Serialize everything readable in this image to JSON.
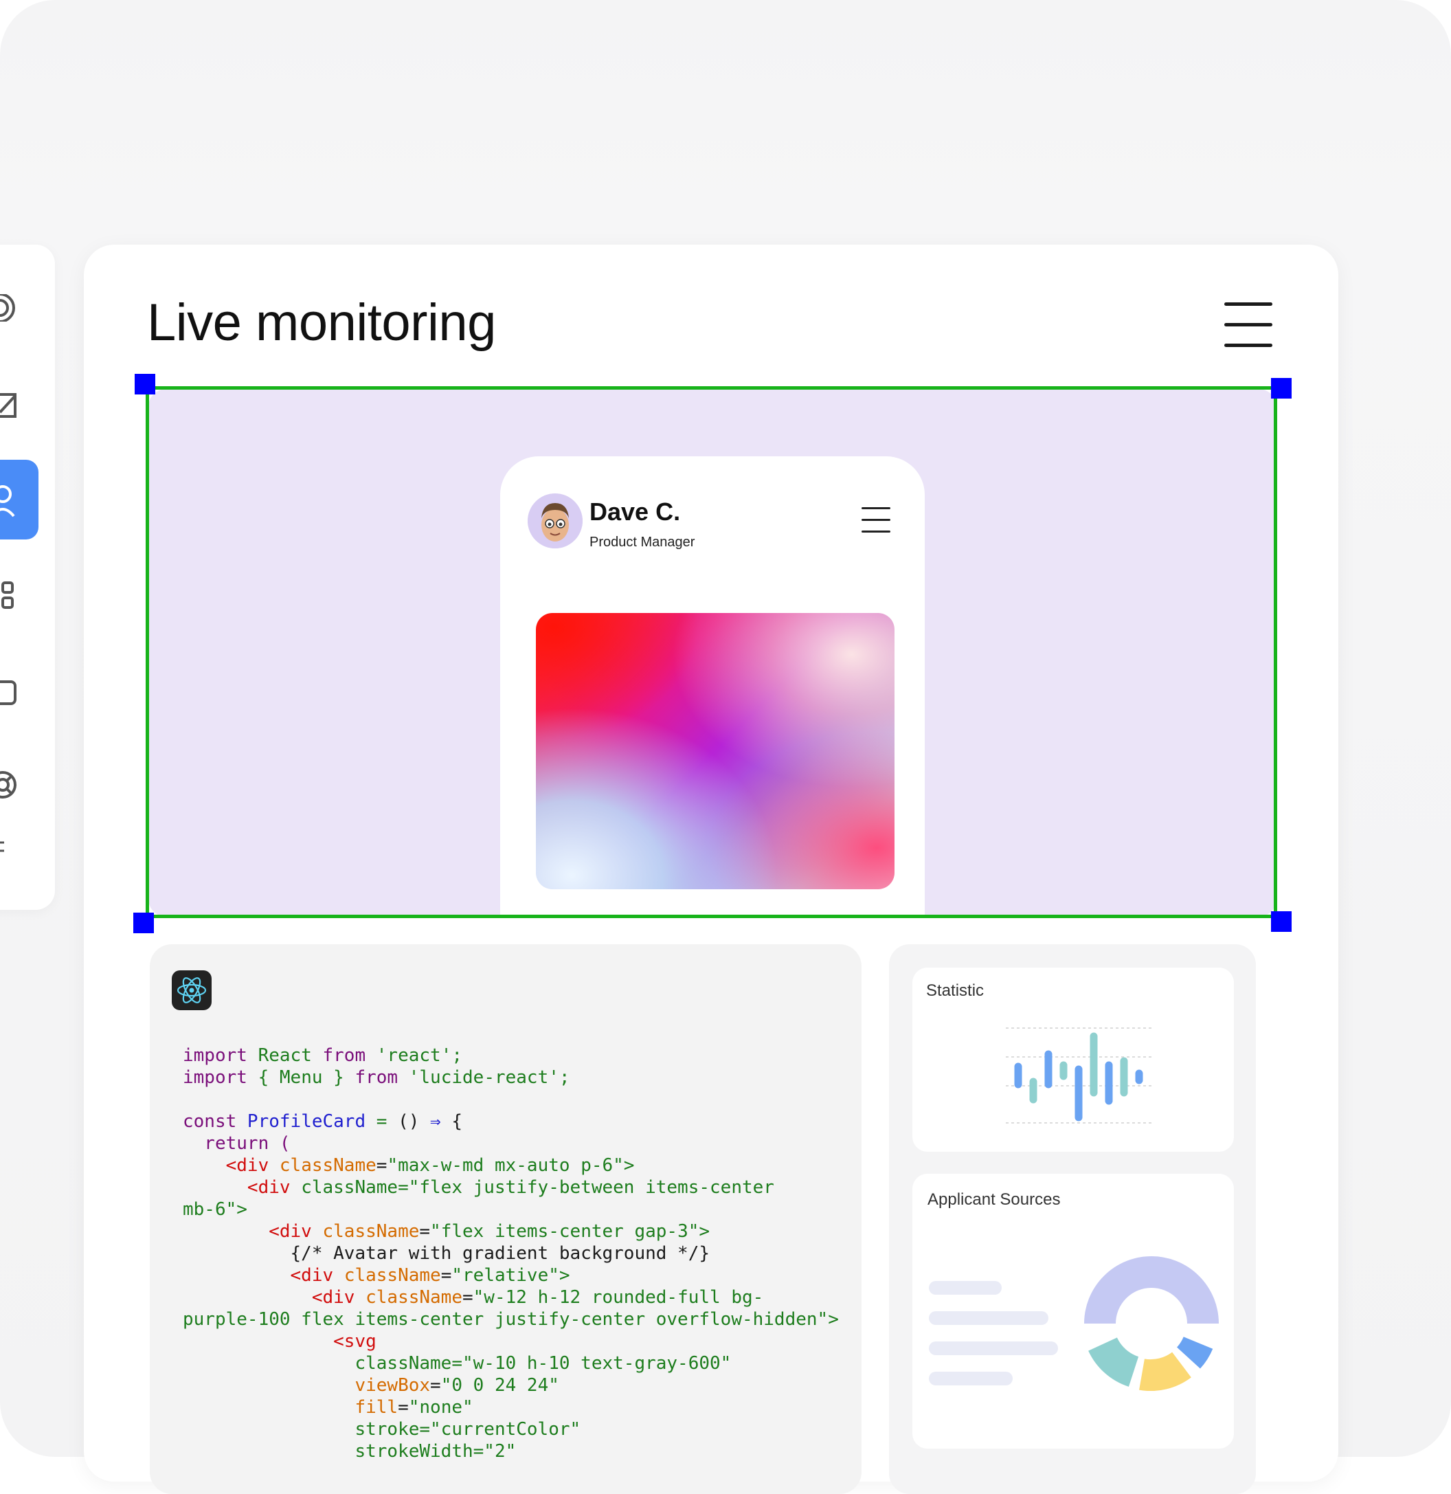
{
  "page": {
    "title": "Live monitoring"
  },
  "profile": {
    "name": "Dave C.",
    "role": "Product Manager"
  },
  "code_snippet": {
    "lines": [
      [
        [
          "kw",
          "import "
        ],
        [
          "str",
          "React "
        ],
        [
          "kw",
          "from "
        ],
        [
          "str",
          "'react';"
        ]
      ],
      [
        [
          "kw",
          "import "
        ],
        [
          "str",
          "{ Menu } "
        ],
        [
          "kw",
          "from "
        ],
        [
          "str",
          "'lucide-react';"
        ]
      ],
      [],
      [
        [
          "kw",
          "const "
        ],
        [
          "id",
          "ProfileCard "
        ],
        [
          "str",
          "= "
        ],
        [
          "plain",
          "() "
        ],
        [
          "id",
          "⇒ "
        ],
        [
          "plain",
          "{"
        ]
      ],
      [
        [
          "kw",
          "  return ("
        ]
      ],
      [
        [
          "tag",
          "    <div "
        ],
        [
          "attr",
          "className"
        ],
        [
          "plain",
          "="
        ],
        [
          "str",
          "\"max-w-md mx-auto p-6\">"
        ]
      ],
      [
        [
          "tag",
          "      <div "
        ],
        [
          "str",
          "className=\"flex justify-between items-center"
        ]
      ],
      [
        [
          "str",
          "mb-6\">"
        ]
      ],
      [
        [
          "tag",
          "        <div "
        ],
        [
          "attr",
          "className"
        ],
        [
          "plain",
          "="
        ],
        [
          "str",
          "\"flex items-center gap-3\">"
        ]
      ],
      [
        [
          "plain",
          "          {/* Avatar with gradient background */}"
        ]
      ],
      [
        [
          "tag",
          "          <div "
        ],
        [
          "attr",
          "className"
        ],
        [
          "plain",
          "="
        ],
        [
          "str",
          "\"relative\">"
        ]
      ],
      [
        [
          "tag",
          "            <div "
        ],
        [
          "attr",
          "className"
        ],
        [
          "plain",
          "="
        ],
        [
          "str",
          "\"w-12 h-12 rounded-full bg-"
        ]
      ],
      [
        [
          "str",
          "purple-100 flex items-center justify-center overflow-hidden\">"
        ]
      ],
      [
        [
          "tag",
          "              <svg"
        ]
      ],
      [
        [
          "str",
          "                className=\"w-10 h-10 text-gray-600\""
        ]
      ],
      [
        [
          "attr",
          "                viewBox"
        ],
        [
          "plain",
          "="
        ],
        [
          "str",
          "\"0 0 24 24\""
        ]
      ],
      [
        [
          "attr",
          "                fill"
        ],
        [
          "plain",
          "="
        ],
        [
          "str",
          "\"none\""
        ]
      ],
      [
        [
          "str",
          "                stroke=\"currentColor\""
        ]
      ],
      [
        [
          "str",
          "                strokeWidth=\"2\""
        ]
      ]
    ]
  },
  "statistic": {
    "title": "Statistic"
  },
  "applicant_sources": {
    "title": "Applicant Sources",
    "colors": [
      "#c5c9f3",
      "#8fd0cf",
      "#fbd873",
      "#6aa3f2"
    ]
  },
  "sidebar": {
    "icons": [
      "target-icon",
      "mail-icon",
      "user-icon",
      "grid-icon",
      "square-icon",
      "lifebuoy-icon"
    ],
    "active": "user-icon"
  },
  "colors": {
    "accent": "#4a8cf7",
    "preview_bg": "#ebe4f8",
    "selection": "#17b31a",
    "handle": "#0000ff"
  }
}
